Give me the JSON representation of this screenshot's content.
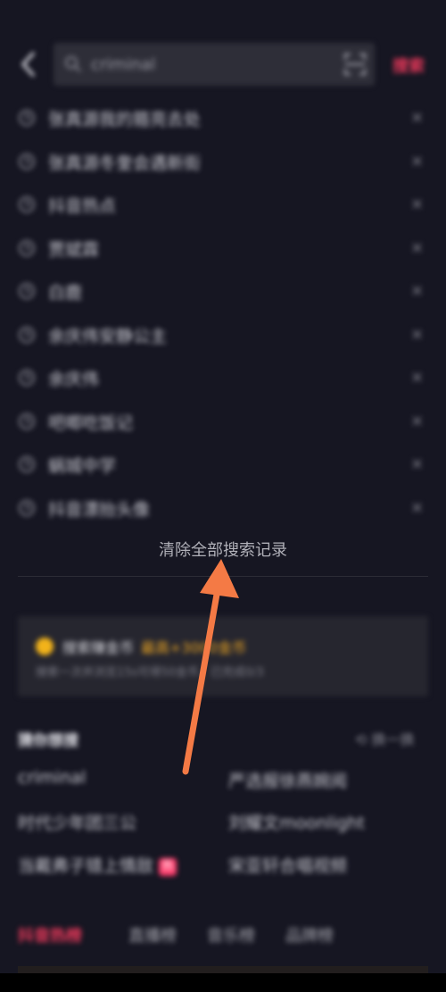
{
  "header": {
    "search_value": "criminal",
    "search_label": "搜索"
  },
  "history": [
    {
      "text": "张真源我的箍亮去处"
    },
    {
      "text": "张真源冬奎会遇新街"
    },
    {
      "text": "抖音热点"
    },
    {
      "text": "贾斌霖"
    },
    {
      "text": "白鹿"
    },
    {
      "text": "余庆伟安静公主"
    },
    {
      "text": "余庆伟"
    },
    {
      "text": "吧唧吃饭记"
    },
    {
      "text": "蜗城中学"
    },
    {
      "text": "抖音漂抬头像"
    }
  ],
  "clear_all_label": "清除全部搜索记录",
  "promo": {
    "title": "搜索赚金币",
    "highlight": "最高+3000金币",
    "subtitle": "搜索一次并浏览15s可得50金币，已完成0/3"
  },
  "guess": {
    "heading": "猜你想搜",
    "refresh_label": "换一换",
    "items": [
      {
        "text": "criminal"
      },
      {
        "text": "严选报徐燕婉阅"
      },
      {
        "text": "时代少年团三公"
      },
      {
        "text": "刘耀文moonlight"
      },
      {
        "text": "当戴弗子错上情敌",
        "badge": "热"
      },
      {
        "text": "宋亚轩合唱视频"
      }
    ]
  },
  "tabs": [
    {
      "label": "抖音热榜",
      "active": true
    },
    {
      "label": "直播榜"
    },
    {
      "label": "音乐榜"
    },
    {
      "label": "品牌榜"
    }
  ],
  "colors": {
    "background": "#161622",
    "accent": "#e8385a",
    "coin": "#f2b31a",
    "annotation_arrow": "#f47a45"
  }
}
